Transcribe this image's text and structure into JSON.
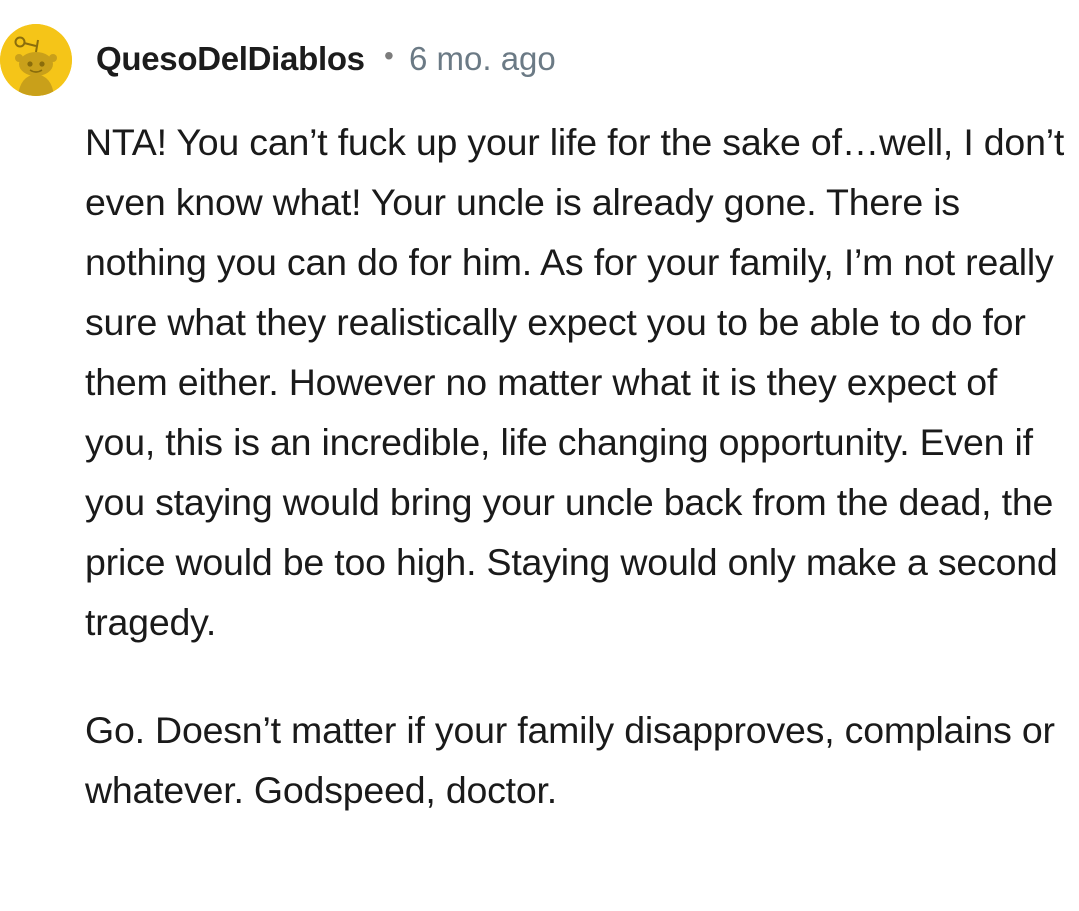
{
  "comment": {
    "author": "QuesoDelDiablos",
    "separator": "•",
    "time": "6 mo. ago",
    "avatar_icon": "snoo-avatar-icon",
    "avatar_color": "#f5c518",
    "paragraphs": [
      "NTA! You can’t fuck up your life for the sake of…well, I don’t even know what! Your uncle is already gone. There is nothing you can do for him. As for your family, I’m not really sure what they realistically expect you to be able to do for them either. However no matter what it is they expect of you, this is an incredible, life changing opportunity. Even if you staying would bring your uncle back from the dead, the price would be too high. Staying would only make a second tragedy.",
      "Go. Doesn’t matter if your family disapproves, complains or whatever. Godspeed, doctor."
    ]
  }
}
